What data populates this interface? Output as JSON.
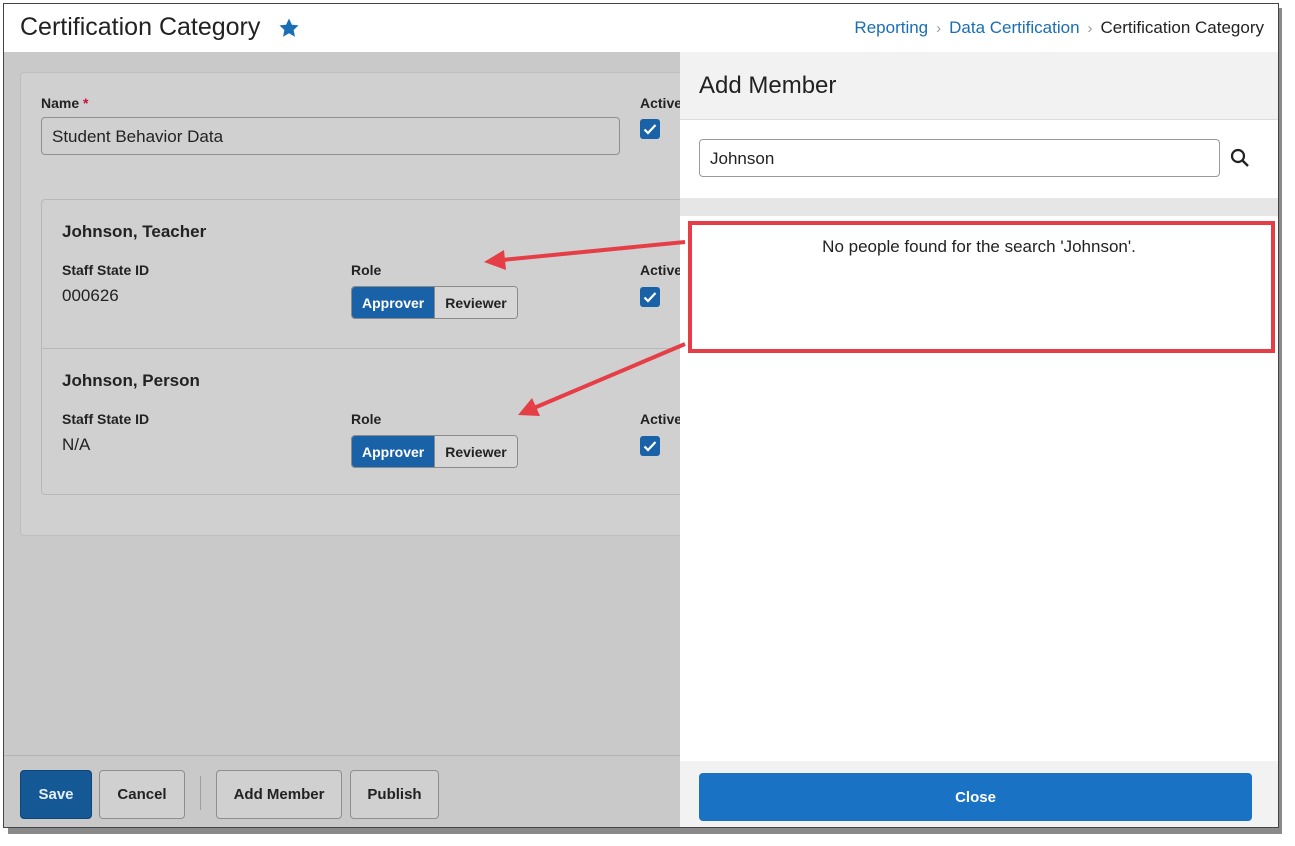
{
  "header": {
    "title": "Certification Category",
    "favorite_icon": "star-icon",
    "breadcrumb": [
      "Reporting",
      "Data Certification",
      "Certification Category"
    ]
  },
  "form": {
    "name_label": "Name",
    "required_marker": "*",
    "name_value": "Student Behavior Data",
    "active_label": "Active",
    "active_checked": true
  },
  "members": [
    {
      "name": "Johnson, Teacher",
      "staff_id_label": "Staff State ID",
      "staff_id": "000626",
      "role_label": "Role",
      "role_options": [
        "Approver",
        "Reviewer"
      ],
      "role_selected": "Approver",
      "active_label": "Active",
      "active_checked": true
    },
    {
      "name": "Johnson, Person",
      "staff_id_label": "Staff State ID",
      "staff_id": "N/A",
      "role_label": "Role",
      "role_options": [
        "Approver",
        "Reviewer"
      ],
      "role_selected": "Approver",
      "active_label": "Active",
      "active_checked": true
    }
  ],
  "footer": {
    "save": "Save",
    "cancel": "Cancel",
    "add_member": "Add Member",
    "publish": "Publish"
  },
  "panel": {
    "title": "Add Member",
    "search_value": "Johnson",
    "search_icon": "search-icon",
    "no_results": "No people found for the search 'Johnson'.",
    "close": "Close"
  },
  "colors": {
    "accent": "#1a62a8",
    "close_button": "#1a72c4",
    "annotation": "#e53e47"
  }
}
